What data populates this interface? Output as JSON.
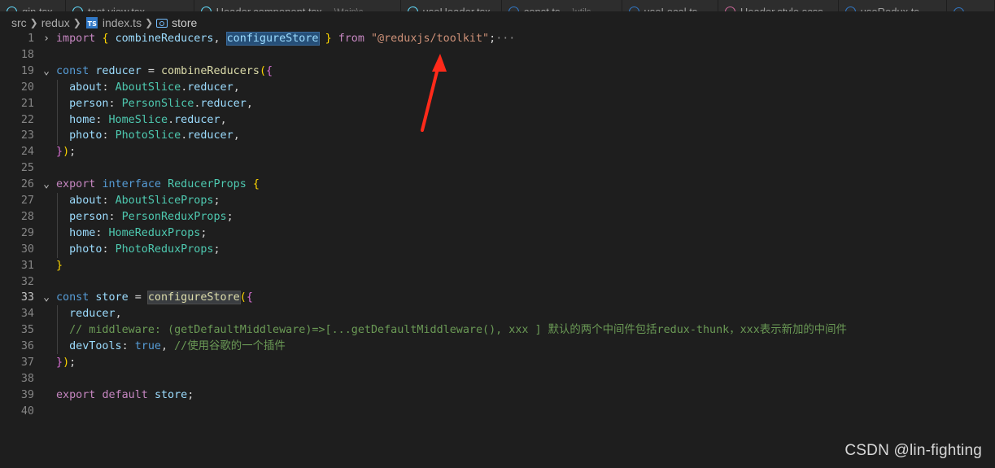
{
  "tabs": [
    {
      "label": "gin.tsx",
      "desc": "",
      "icon": "react-icon",
      "color": "#61dafb"
    },
    {
      "label": "test.view.tsx",
      "desc": "",
      "icon": "react-icon",
      "color": "#61dafb"
    },
    {
      "label": "Header.component.tsx",
      "desc": "...\\Main\\c...",
      "icon": "react-icon",
      "color": "#61dafb"
    },
    {
      "label": "useHeader.tsx",
      "desc": "",
      "icon": "react-icon",
      "color": "#61dafb"
    },
    {
      "label": "const.ts",
      "desc": "...\\utils",
      "icon": "typescript-icon",
      "color": "#3178c6"
    },
    {
      "label": "useLocal.ts",
      "desc": "",
      "icon": "typescript-icon",
      "color": "#3178c6"
    },
    {
      "label": "Header.style.scss",
      "desc": "",
      "icon": "sass-icon",
      "color": "#cd6799"
    },
    {
      "label": "useRedux.ts",
      "desc": "",
      "icon": "typescript-icon",
      "color": "#3178c6"
    },
    {
      "label": "",
      "desc": "",
      "icon": "typescript-icon",
      "color": "#3178c6"
    }
  ],
  "breadcrumb": {
    "items": [
      "src",
      "redux",
      "index.ts",
      "store"
    ],
    "file_icon_text": "TS"
  },
  "editor": {
    "lines": [
      {
        "n": "1",
        "fold": "›",
        "current": false,
        "tokens": [
          [
            "kw2",
            "import"
          ],
          [
            "punc",
            " "
          ],
          [
            "br1",
            "{"
          ],
          [
            "punc",
            " "
          ],
          [
            "var",
            "combineReducers"
          ],
          [
            "punc",
            ", "
          ],
          [
            "var sel-hl",
            "configureStore"
          ],
          [
            "punc",
            " "
          ],
          [
            "br1",
            "}"
          ],
          [
            "punc",
            " "
          ],
          [
            "kw2",
            "from"
          ],
          [
            "punc",
            " "
          ],
          [
            "str",
            "\"@reduxjs/toolkit\""
          ],
          [
            "punc",
            ";"
          ],
          [
            "dim",
            "···"
          ]
        ]
      },
      {
        "n": "18",
        "fold": "",
        "current": false,
        "tokens": []
      },
      {
        "n": "19",
        "fold": "⌄",
        "current": false,
        "tokens": [
          [
            "kw",
            "const"
          ],
          [
            "punc",
            " "
          ],
          [
            "var",
            "reducer"
          ],
          [
            "punc",
            " = "
          ],
          [
            "fn",
            "combineReducers"
          ],
          [
            "br1",
            "("
          ],
          [
            "br2",
            "{"
          ]
        ]
      },
      {
        "n": "20",
        "fold": "",
        "current": false,
        "tokens": [
          [
            "punc",
            "  "
          ],
          [
            "var",
            "about"
          ],
          [
            "punc",
            ": "
          ],
          [
            "cls",
            "AboutSlice"
          ],
          [
            "punc",
            "."
          ],
          [
            "var",
            "reducer"
          ],
          [
            "punc",
            ","
          ]
        ]
      },
      {
        "n": "21",
        "fold": "",
        "current": false,
        "tokens": [
          [
            "punc",
            "  "
          ],
          [
            "var",
            "person"
          ],
          [
            "punc",
            ": "
          ],
          [
            "cls",
            "PersonSlice"
          ],
          [
            "punc",
            "."
          ],
          [
            "var",
            "reducer"
          ],
          [
            "punc",
            ","
          ]
        ]
      },
      {
        "n": "22",
        "fold": "",
        "current": false,
        "tokens": [
          [
            "punc",
            "  "
          ],
          [
            "var",
            "home"
          ],
          [
            "punc",
            ": "
          ],
          [
            "cls",
            "HomeSlice"
          ],
          [
            "punc",
            "."
          ],
          [
            "var",
            "reducer"
          ],
          [
            "punc",
            ","
          ]
        ]
      },
      {
        "n": "23",
        "fold": "",
        "current": false,
        "tokens": [
          [
            "punc",
            "  "
          ],
          [
            "var",
            "photo"
          ],
          [
            "punc",
            ": "
          ],
          [
            "cls",
            "PhotoSlice"
          ],
          [
            "punc",
            "."
          ],
          [
            "var",
            "reducer"
          ],
          [
            "punc",
            ","
          ]
        ]
      },
      {
        "n": "24",
        "fold": "",
        "current": false,
        "tokens": [
          [
            "br2",
            "}"
          ],
          [
            "br1",
            ")"
          ],
          [
            "punc",
            ";"
          ]
        ]
      },
      {
        "n": "25",
        "fold": "",
        "current": false,
        "tokens": []
      },
      {
        "n": "26",
        "fold": "⌄",
        "current": false,
        "tokens": [
          [
            "kw2",
            "export"
          ],
          [
            "punc",
            " "
          ],
          [
            "kw",
            "interface"
          ],
          [
            "punc",
            " "
          ],
          [
            "cls",
            "ReducerProps"
          ],
          [
            "punc",
            " "
          ],
          [
            "br1",
            "{"
          ]
        ]
      },
      {
        "n": "27",
        "fold": "",
        "current": false,
        "tokens": [
          [
            "punc",
            "  "
          ],
          [
            "var",
            "about"
          ],
          [
            "punc",
            ": "
          ],
          [
            "cls",
            "AboutSliceProps"
          ],
          [
            "punc",
            ";"
          ]
        ]
      },
      {
        "n": "28",
        "fold": "",
        "current": false,
        "tokens": [
          [
            "punc",
            "  "
          ],
          [
            "var",
            "person"
          ],
          [
            "punc",
            ": "
          ],
          [
            "cls",
            "PersonReduxProps"
          ],
          [
            "punc",
            ";"
          ]
        ]
      },
      {
        "n": "29",
        "fold": "",
        "current": false,
        "tokens": [
          [
            "punc",
            "  "
          ],
          [
            "var",
            "home"
          ],
          [
            "punc",
            ": "
          ],
          [
            "cls",
            "HomeReduxProps"
          ],
          [
            "punc",
            ";"
          ]
        ]
      },
      {
        "n": "30",
        "fold": "",
        "current": false,
        "tokens": [
          [
            "punc",
            "  "
          ],
          [
            "var",
            "photo"
          ],
          [
            "punc",
            ": "
          ],
          [
            "cls",
            "PhotoReduxProps"
          ],
          [
            "punc",
            ";"
          ]
        ]
      },
      {
        "n": "31",
        "fold": "",
        "current": false,
        "tokens": [
          [
            "br1",
            "}"
          ]
        ]
      },
      {
        "n": "32",
        "fold": "",
        "current": false,
        "tokens": []
      },
      {
        "n": "33",
        "fold": "⌄",
        "current": true,
        "tokens": [
          [
            "kw",
            "const"
          ],
          [
            "punc",
            " "
          ],
          [
            "var",
            "store"
          ],
          [
            "punc",
            " = "
          ],
          [
            "fn word-hl",
            "configureStore"
          ],
          [
            "br1",
            "("
          ],
          [
            "br2",
            "{"
          ]
        ]
      },
      {
        "n": "34",
        "fold": "",
        "current": false,
        "tokens": [
          [
            "punc",
            "  "
          ],
          [
            "var",
            "reducer"
          ],
          [
            "punc",
            ","
          ]
        ]
      },
      {
        "n": "35",
        "fold": "",
        "current": false,
        "tokens": [
          [
            "punc",
            "  "
          ],
          [
            "cmt",
            "// middleware: (getDefaultMiddleware)=>[...getDefaultMiddleware(), xxx ] 默认的两个中间件包括redux-thunk，xxx表示新加的中间件"
          ]
        ]
      },
      {
        "n": "36",
        "fold": "",
        "current": false,
        "tokens": [
          [
            "punc",
            "  "
          ],
          [
            "var",
            "devTools"
          ],
          [
            "punc",
            ": "
          ],
          [
            "kw",
            "true"
          ],
          [
            "punc",
            ", "
          ],
          [
            "cmt",
            "//使用谷歌的一个插件"
          ]
        ]
      },
      {
        "n": "37",
        "fold": "",
        "current": false,
        "tokens": [
          [
            "br2",
            "}"
          ],
          [
            "br1",
            ")"
          ],
          [
            "punc",
            ";"
          ]
        ]
      },
      {
        "n": "38",
        "fold": "",
        "current": false,
        "tokens": []
      },
      {
        "n": "39",
        "fold": "",
        "current": false,
        "tokens": [
          [
            "kw2",
            "export"
          ],
          [
            "punc",
            " "
          ],
          [
            "kw2",
            "default"
          ],
          [
            "punc",
            " "
          ],
          [
            "var",
            "store"
          ],
          [
            "punc",
            ";"
          ]
        ]
      },
      {
        "n": "40",
        "fold": "",
        "current": false,
        "tokens": []
      }
    ]
  },
  "annotation": {
    "arrow_color": "#ff2a1a"
  },
  "watermark": "CSDN @lin-fighting"
}
